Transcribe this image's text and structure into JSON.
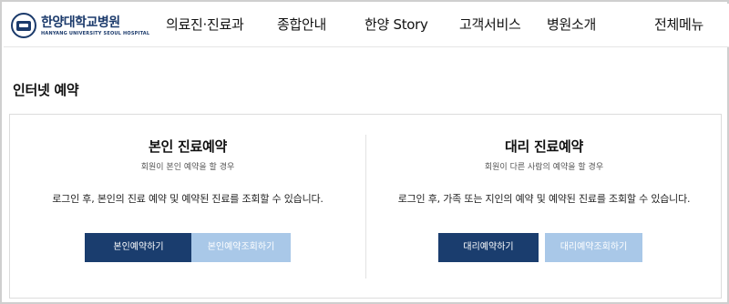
{
  "header": {
    "logo_name": "한양대학교병원",
    "logo_sub": "HANYANG UNIVERSITY SEOUL HOSPITAL",
    "nav": [
      {
        "label": "의료진·진료과"
      },
      {
        "label": "종합안내"
      },
      {
        "label": "한양 Story"
      },
      {
        "label": "고객서비스"
      },
      {
        "label": "병원소개"
      },
      {
        "label": "전체메뉴"
      }
    ]
  },
  "page": {
    "title": "인터넷 예약"
  },
  "panels": [
    {
      "title": "본인 진료예약",
      "subtitle": "회원이 본인 예약을 할 경우",
      "description": "로그인 후, 본인의 진료 예약 및 예약된 진료를 조회할 수 있습니다.",
      "primary_button": "본인예약하기",
      "secondary_button": "본인예약조회하기"
    },
    {
      "title": "대리 진료예약",
      "subtitle": "회원이 다른 사람의 예약을 할 경우",
      "description": "로그인 후, 가족 또는 지인의 예약 및 예약된 진료를 조회할 수 있습니다.",
      "primary_button": "대리예약하기",
      "secondary_button": "대리예약조회하기"
    }
  ],
  "colors": {
    "brand_navy": "#1a3d6e",
    "button_light": "#a9c8e8"
  }
}
